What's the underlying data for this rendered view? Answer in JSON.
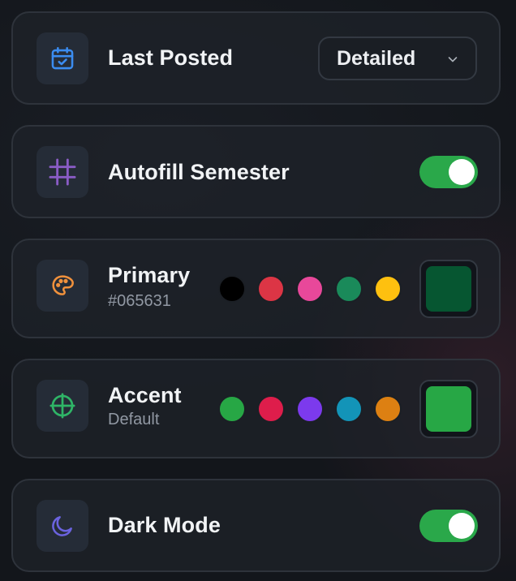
{
  "last_posted": {
    "title": "Last Posted",
    "icon": "calendar-check-icon",
    "icon_color": "#3b8cf0",
    "select_value": "Detailed"
  },
  "autofill": {
    "title": "Autofill Semester",
    "icon": "grid-hash-icon",
    "icon_color": "#8a5cc6",
    "toggle_on": true
  },
  "primary": {
    "title": "Primary",
    "subtitle": "#065631",
    "icon": "palette-icon",
    "icon_color": "#f0913c",
    "swatches": [
      "#000000",
      "#dc3545",
      "#e8489a",
      "#1a8a5a",
      "#fec00f"
    ],
    "selected_color": "#065631"
  },
  "accent": {
    "title": "Accent",
    "subtitle": "Default",
    "icon": "crosshair-icon",
    "icon_color": "#2fb567",
    "swatches": [
      "#27a745",
      "#de1d4b",
      "#7c3aed",
      "#1394b8",
      "#dd8012"
    ],
    "selected_color": "#27a745"
  },
  "dark_mode": {
    "title": "Dark Mode",
    "icon": "moon-icon",
    "icon_color": "#6b63e0",
    "toggle_on": true
  }
}
